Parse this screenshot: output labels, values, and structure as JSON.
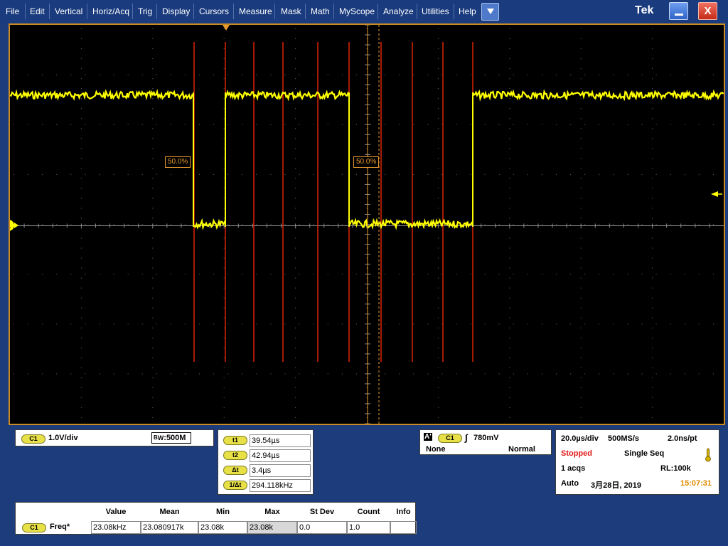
{
  "menu": {
    "items": [
      "File",
      "Edit",
      "Vertical",
      "Horiz/Acq",
      "Trig",
      "Display",
      "Cursors",
      "Measure",
      "Mask",
      "Math",
      "MyScope",
      "Analyze",
      "Utilities",
      "Help"
    ],
    "logo": "Tek",
    "close_label": "X"
  },
  "waveform": {
    "channel_marker": "1",
    "cursor_a_label": "50.0%",
    "cursor_b_label": "50.0%",
    "trace_color": "#ffff00",
    "cursor_color": "#e89a2e",
    "pulse_color": "#ff2a00"
  },
  "channel": {
    "badge": "C1",
    "scale": "1.0V/div",
    "bw_prefix": "B",
    "bw_sub": "W",
    "bw_value": ":500M"
  },
  "cursors": {
    "rows": [
      {
        "label": "t1",
        "value": "39.54µs"
      },
      {
        "label": "t2",
        "value": "42.94µs"
      },
      {
        "label": "Δt",
        "value": "3.4µs"
      },
      {
        "label": "1/Δt",
        "value": "294.118kHz"
      }
    ]
  },
  "trigger": {
    "a_label": "A'",
    "badge": "C1",
    "slope_symbol": "∫",
    "level": "780mV",
    "coupling": "None",
    "mode": "Normal"
  },
  "acquisition": {
    "timebase": "20.0µs/div",
    "sample_rate": "500MS/s",
    "resolution": "2.0ns/pt",
    "state": "Stopped",
    "seq": "Single Seq",
    "acqs": "1 acqs",
    "rl": "RL:100k",
    "auto": "Auto",
    "date": "3月28日, 2019",
    "time": "15:07:31"
  },
  "measurements": {
    "headers": [
      "Value",
      "Mean",
      "Min",
      "Max",
      "St Dev",
      "Count",
      "Info"
    ],
    "rows": [
      {
        "badge": "C1",
        "name": "Freq*",
        "values": [
          "23.08kHz",
          "23.080917k",
          "23.08k",
          "23.08k",
          "0.0",
          "1.0",
          ""
        ]
      }
    ]
  }
}
